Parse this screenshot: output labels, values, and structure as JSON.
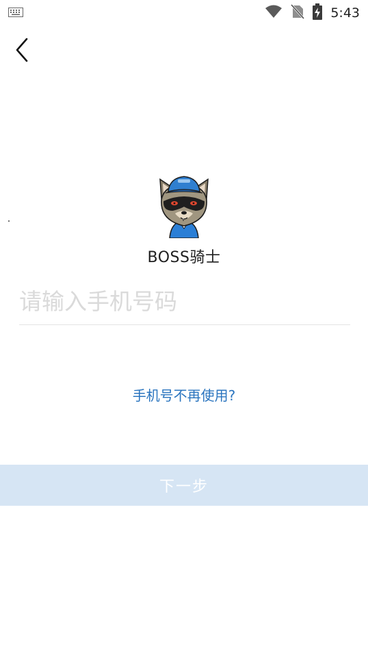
{
  "status_bar": {
    "time": "5:43",
    "icons": [
      "keyboard-icon",
      "wifi-icon",
      "no-sim-icon",
      "battery-charging-icon"
    ]
  },
  "header": {
    "back_icon": "back-arrow-icon"
  },
  "logo": {
    "app_name": "BOSS骑士",
    "mascot": "raccoon-mascot-icon"
  },
  "form": {
    "phone_placeholder": "请输入手机号码",
    "phone_value": ""
  },
  "links": {
    "phone_not_used": "手机号不再使用?"
  },
  "actions": {
    "next_label": "下一步"
  },
  "colors": {
    "link": "#2b75bf",
    "button_disabled_bg": "#d6e5f4",
    "button_text": "#ffffff",
    "placeholder": "#dadada",
    "mascot_cap": "#2f7fd0",
    "mascot_shirt": "#2b7fd6"
  }
}
